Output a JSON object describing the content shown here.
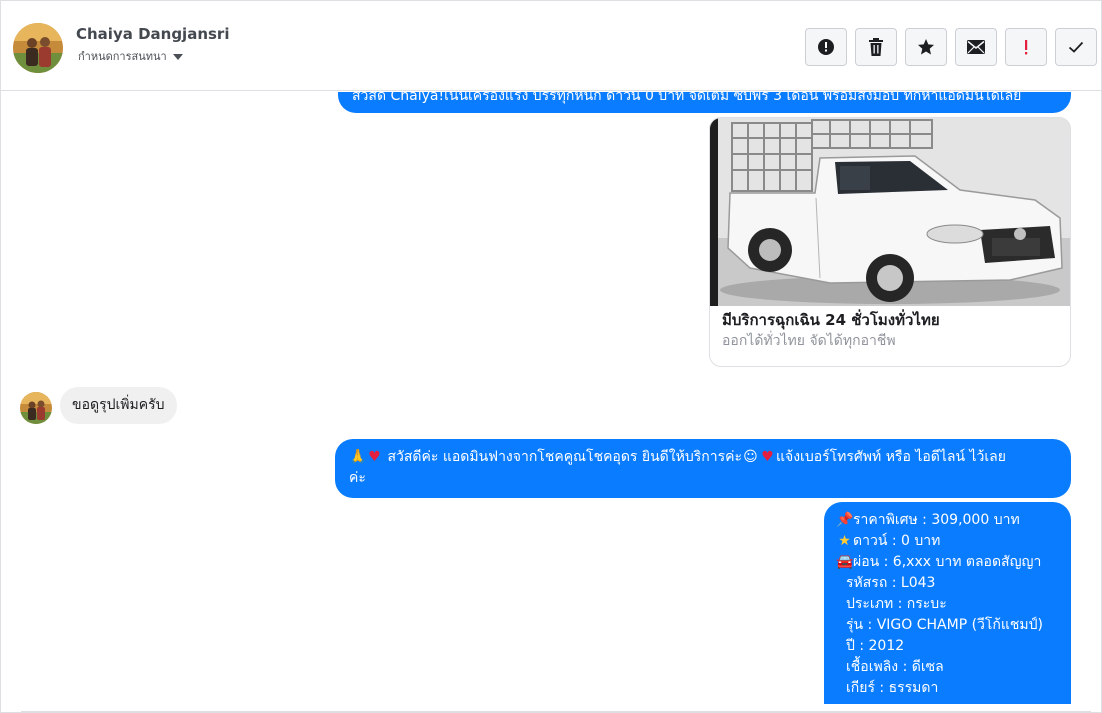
{
  "header": {
    "contact_name": "Chaiya Dangjansri",
    "label_link": "กำหนดการสนทนา",
    "actions": [
      {
        "name": "report-button",
        "icon": "alert-circle-icon"
      },
      {
        "name": "delete-button",
        "icon": "trash-icon"
      },
      {
        "name": "star-button",
        "icon": "star-icon"
      },
      {
        "name": "mail-button",
        "icon": "mail-icon"
      },
      {
        "name": "priority-button",
        "icon": "exclamation-icon"
      },
      {
        "name": "done-button",
        "icon": "check-icon"
      }
    ]
  },
  "messages": {
    "m1_text": "สวัสดี Chaiya!เน้นเครื่องแรง บรรทุกหนัก ดาวน์ 0 บาท จัดเต็ม ซับพร 3 เดือน พร้อมส่งมอบ ทักหาแอดมินได้เลย",
    "card": {
      "title": "มีบริการฉุกเฉิน 24 ชั่วโมงทั่วไทย",
      "subtitle": "ออกได้ทั่วไทย จัดได้ทุกอาชีพ"
    },
    "m2_text": "ขอดูรุปเพิ่มครับ",
    "m3_line1": "สวัสดีค่ะ แอดมินฟางจากโชคคูณโชคอุดร ยินดีให้บริการค่ะ",
    "m3_line1b": "แจ้งเบอร์โทรศัพท์ หรือ ไอดีไลน์  ไว้เลย",
    "m3_line2": "ค่ะ",
    "specs": {
      "price": "ราคาพิเศษ : 309,000 บาท",
      "down": "ดาวน์ : 0 บาท",
      "installment": "ผ่อน : 6,xxx บาท ตลอดสัญญา",
      "code": "รหัสรถ : L043",
      "type": "ประเภท : กระบะ",
      "model": "รุ่น : VIGO CHAMP (วีโก้แชมป์)",
      "year": "ปี : 2012",
      "fuel": "เชื้อเพลิง : ดีเซล",
      "gear": "เกียร์ : ธรรมดา"
    }
  },
  "colors": {
    "outgoing_bubble": "#0a7cff",
    "incoming_bubble": "#f1f0f0",
    "border": "#dddfe2"
  }
}
